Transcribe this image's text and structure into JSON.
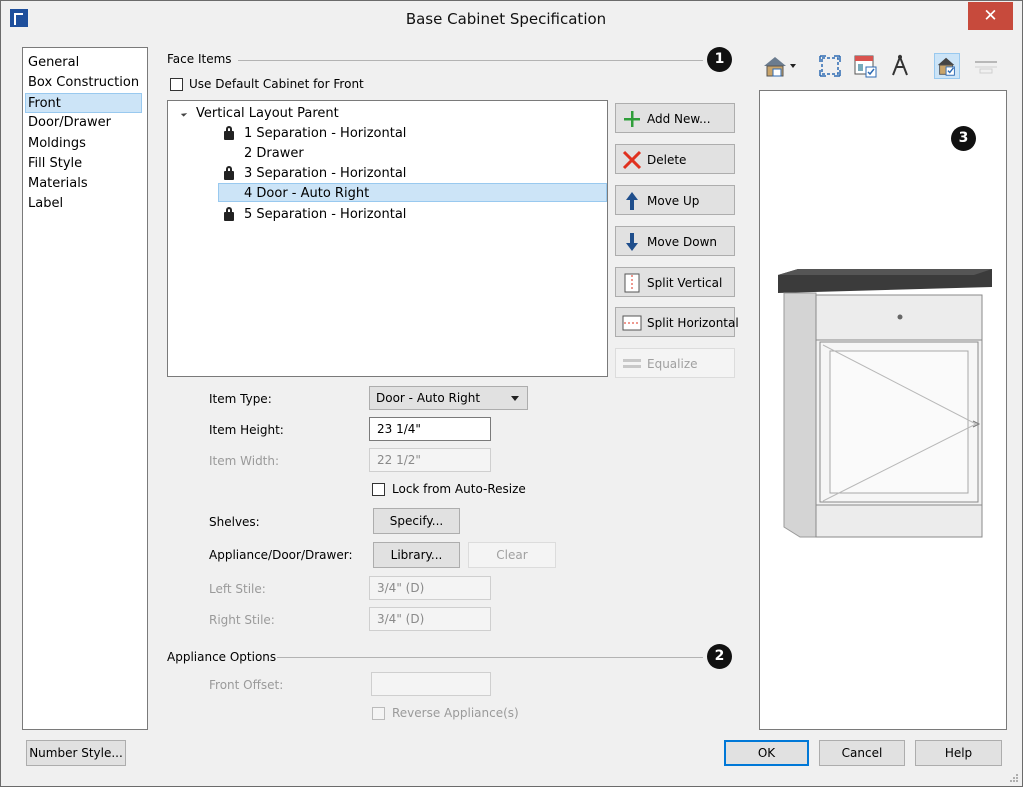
{
  "window": {
    "title": "Base Cabinet Specification",
    "close_glyph": "✕"
  },
  "categories": [
    "General",
    "Box Construction",
    "Front",
    "Door/Drawer",
    "Moldings",
    "Fill Style",
    "Materials",
    "Label"
  ],
  "selected_category": "Front",
  "face_items": {
    "group_label": "Face Items",
    "badge": "1",
    "use_default_label": "Use Default Cabinet for Front",
    "use_default_checked": false,
    "tree": {
      "root": "Vertical Layout Parent",
      "items": [
        {
          "label": "1 Separation - Horizontal",
          "locked": true
        },
        {
          "label": "2 Drawer",
          "locked": false
        },
        {
          "label": "3 Separation - Horizontal",
          "locked": true
        },
        {
          "label": "4 Door - Auto Right",
          "locked": false,
          "selected": true
        },
        {
          "label": "5 Separation - Horizontal",
          "locked": true
        }
      ]
    },
    "buttons": {
      "add_new": "Add New...",
      "delete": "Delete",
      "move_up": "Move Up",
      "move_down": "Move Down",
      "split_vertical": "Split Vertical",
      "split_horizontal": "Split Horizontal",
      "equalize": "Equalize"
    }
  },
  "item": {
    "type_label": "Item Type:",
    "type_value": "Door - Auto Right",
    "height_label": "Item Height:",
    "height_value": "23 1/4\"",
    "width_label": "Item Width:",
    "width_value": "22 1/2\"",
    "lock_label": "Lock from Auto-Resize",
    "shelves_label": "Shelves:",
    "specify_button": "Specify...",
    "appliance_label": "Appliance/Door/Drawer:",
    "library_button": "Library...",
    "clear_button": "Clear",
    "left_stile_label": "Left Stile:",
    "left_stile_value": "3/4\" (D)",
    "right_stile_label": "Right Stile:",
    "right_stile_value": "3/4\" (D)"
  },
  "appliance_options": {
    "group_label": "Appliance Options",
    "badge": "2",
    "front_offset_label": "Front Offset:",
    "front_offset_value": "",
    "reverse_label": "Reverse Appliance(s)"
  },
  "preview": {
    "badge": "3",
    "toolbar_icons": [
      "camera-view-icon",
      "fill-window-icon",
      "preview-options-icon",
      "render-style-icon",
      "color-toggle-icon",
      "dimension-icon"
    ]
  },
  "footer": {
    "number_style_button": "Number Style...",
    "ok_button": "OK",
    "cancel_button": "Cancel",
    "help_button": "Help"
  },
  "colors": {
    "selection": "#cce4f7",
    "close_button": "#c74a3c",
    "cabinet_top": "#2b2b2b"
  }
}
